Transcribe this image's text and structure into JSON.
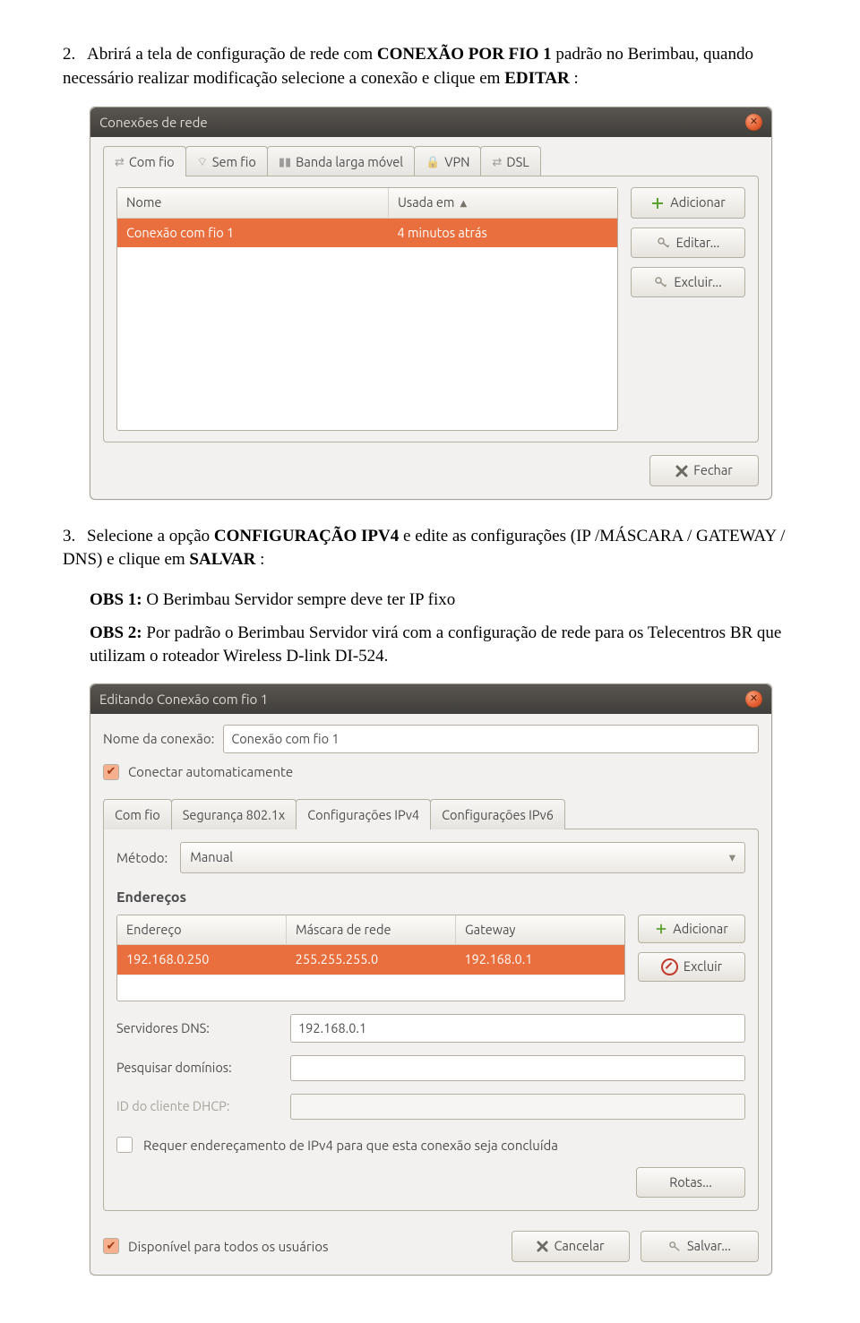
{
  "step2": {
    "num": "2.",
    "lead": "Abrirá a tela de configuração de rede com ",
    "bold1": "CONEXÃO POR FIO 1",
    "mid": " padrão no Berimbau, quando necessário realizar modificação selecione a conexão e clique em ",
    "bold2": "EDITAR",
    "tail": ":"
  },
  "window1": {
    "title": "Conexões de rede",
    "tabs": [
      "Com fio",
      "Sem fio",
      "Banda larga móvel",
      "VPN",
      "DSL"
    ],
    "activeTab": 0,
    "header": {
      "name": "Nome",
      "used": "Usada em"
    },
    "row": {
      "name": "Conexão com fio 1",
      "used": "4 minutos atrás"
    },
    "buttons": {
      "add": "Adicionar",
      "edit": "Editar...",
      "delete": "Excluir...",
      "close": "Fechar"
    }
  },
  "step3": {
    "num": "3.",
    "lead": "Selecione a opção ",
    "bold1": "CONFIGURAÇÃO IPV4",
    "tail1": " e edite as configurações (IP /MÁSCARA / GATEWAY / DNS) e clique em ",
    "bold2": "SALVAR",
    "tail2": ":"
  },
  "obs1": {
    "label": "OBS 1:",
    "text": " O Berimbau Servidor sempre deve ter IP fixo"
  },
  "obs2": {
    "label": "OBS 2:",
    "text": " Por padrão o Berimbau Servidor virá com a configuração de rede para os Telecentros BR que utilizam o roteador Wireless D-link DI-524."
  },
  "window2": {
    "title": "Editando Conexão com fio 1",
    "connNameLabel": "Nome da conexão:",
    "connName": "Conexão com fio 1",
    "autoConnect": "Conectar automaticamente",
    "tabs": [
      "Com fio",
      "Segurança 802.1x",
      "Configurações IPv4",
      "Configurações IPv6"
    ],
    "activeTab": 2,
    "methodLabel": "Método:",
    "method": "Manual",
    "addrSection": "Endereços",
    "addrHead": {
      "addr": "Endereço",
      "mask": "Máscara de rede",
      "gw": "Gateway"
    },
    "addrRow": {
      "addr": "192.168.0.250",
      "mask": "255.255.255.0",
      "gw": "192.168.0.1"
    },
    "addrButtons": {
      "add": "Adicionar",
      "delete": "Excluir"
    },
    "dnsLabel": "Servidores DNS:",
    "dns": "192.168.0.1",
    "searchLabel": "Pesquisar domínios:",
    "dhcpLabel": "ID do cliente DHCP:",
    "requireIpv4": "Requer endereçamento de IPv4 para que esta conexão seja concluída",
    "routes": "Rotas...",
    "availAll": "Disponível para todos os usuários",
    "cancel": "Cancelar",
    "save": "Salvar..."
  }
}
